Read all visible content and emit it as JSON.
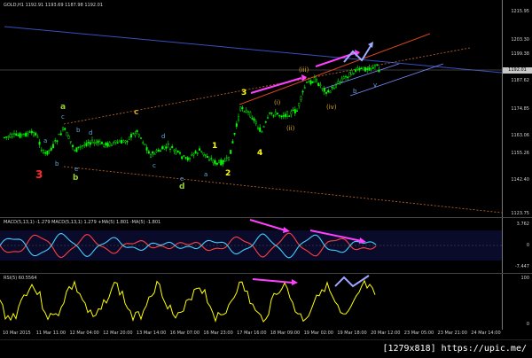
{
  "window": {
    "chart_title": "GOLD,H1  1192.91 1193.69 1187.98 1192.01",
    "current_price": "1192.01"
  },
  "main_price_axis": [
    "1215.95",
    "1203.30",
    "1199.38",
    "1187.62",
    "1174.85",
    "1163.06",
    "1155.26",
    "1142.40",
    "1123.75"
  ],
  "wave_labels": {
    "a": "a",
    "b": "b",
    "c": "c",
    "d": "d",
    "three_red": "3",
    "one": "1",
    "two": "2",
    "three": "3",
    "four": "4",
    "i": "(i)",
    "ii": "(ii)",
    "iii": "(iii)",
    "iv": "(iv)",
    "v": "v",
    "sub_a": "a",
    "sub_b": "b",
    "sub_c": "c",
    "sub_d": "d",
    "sub_e": "e"
  },
  "macd": {
    "title": "MACD(5,13,1) -1.279  MACD(5,13,1) 1.279  +MA(5) 1.801  -MA(5) -1.801",
    "axis": [
      "3.762",
      "0",
      "-7.447"
    ]
  },
  "rsi": {
    "title": "RSI(5) 60.5564",
    "axis": [
      "100",
      "0"
    ]
  },
  "time_axis": [
    "10 Mar 2015",
    "11 Mar 11:00",
    "12 Mar 04:00",
    "12 Mar 20:00",
    "13 Mar 14:00",
    "16 Mar 07:00",
    "16 Mar 23:00",
    "17 Mar 16:00",
    "18 Mar 09:00",
    "19 Mar 02:00",
    "19 Mar 18:00",
    "20 Mar 12:00",
    "23 Mar 05:00",
    "23 Mar 21:00",
    "24 Mar 14:00"
  ],
  "footer": "[1279x818]  https://upic.me/",
  "colors": {
    "bull": "#00ff00",
    "bear": "#00cc00",
    "trend_blue": "#3a4fbf",
    "trend_red": "#d0441e",
    "orange_dotted": "#c96a2a",
    "magenta": "#ff40ff",
    "light_blue": "#a0a8ff",
    "rsi": "#ffff00",
    "macd_red": "#ff4040",
    "macd_cyan": "#40d0ff"
  }
}
